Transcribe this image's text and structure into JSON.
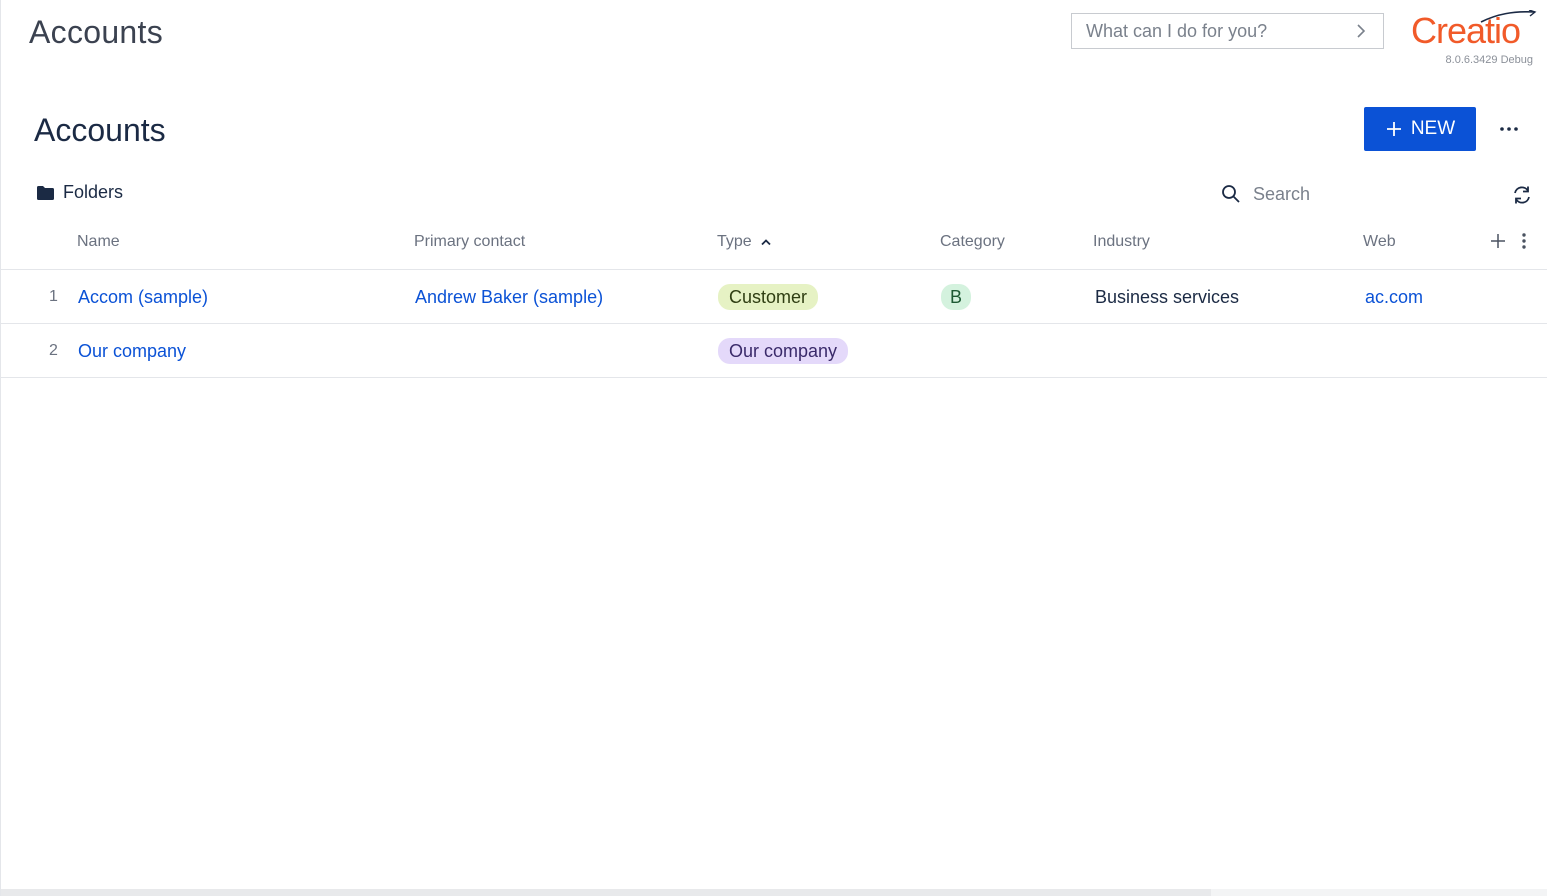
{
  "header": {
    "title": "Accounts",
    "command_placeholder": "What can I do for you?",
    "logo_text": "Creatio",
    "version": "8.0.6.3429 Debug"
  },
  "section": {
    "title": "Accounts",
    "new_label": "NEW",
    "folders_label": "Folders",
    "search_placeholder": "Search"
  },
  "grid": {
    "columns": [
      "Name",
      "Primary contact",
      "Type",
      "Category",
      "Industry",
      "Web"
    ],
    "sort": {
      "column": "Type",
      "direction": "ascending"
    },
    "rows": [
      {
        "num": "1",
        "name": "Accom (sample)",
        "primary_contact": "Andrew Baker (sample)",
        "type": "Customer",
        "category": "B",
        "industry": "Business services",
        "web": "ac.com"
      },
      {
        "num": "2",
        "name": "Our company",
        "primary_contact": "",
        "type": "Our company",
        "category": "",
        "industry": "",
        "web": ""
      }
    ]
  },
  "colors": {
    "accent": "#0b52d6",
    "brand": "#f15a29",
    "tag_customer": "#e6f2c4",
    "tag_our_company": "#e4d9fa",
    "tag_category": "#d4f2de"
  },
  "icons": {
    "command_go": "chevron-right-icon",
    "new": "plus-icon",
    "more": "more-horizontal-icon",
    "folders": "folder-icon",
    "search": "search-icon",
    "refresh": "refresh-icon",
    "sort": "chevron-up-icon",
    "add_column": "plus-icon",
    "column_menu": "more-vertical-icon"
  }
}
